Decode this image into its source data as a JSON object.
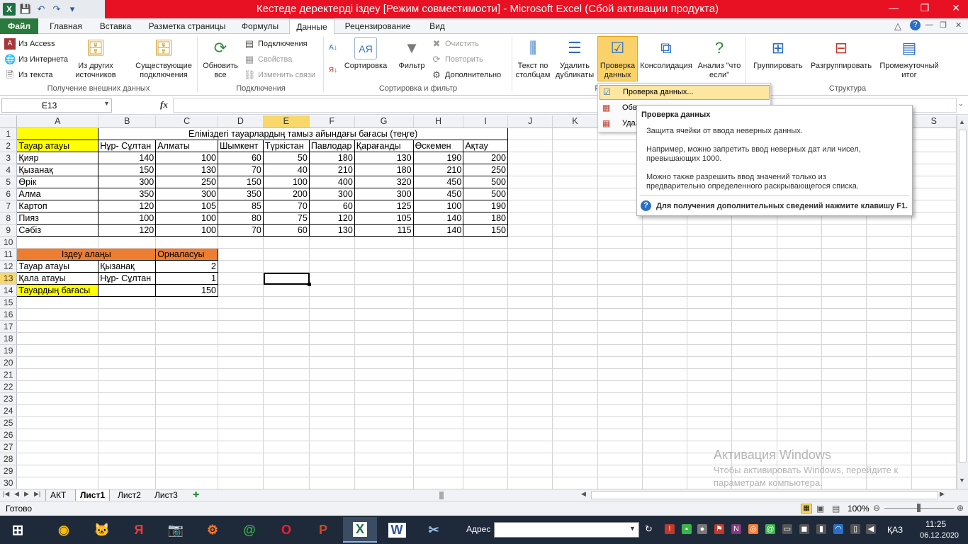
{
  "window": {
    "title": "Кестеде деректерді іздеу  [Режим совместимости]  -  Microsoft Excel (Сбой активации продукта)",
    "app_icon": "X"
  },
  "tabs": [
    "Файл",
    "Главная",
    "Вставка",
    "Разметка страницы",
    "Формулы",
    "Данные",
    "Рецензирование",
    "Вид"
  ],
  "active_tab": "Данные",
  "ribbon": {
    "get_external": {
      "access": "Из Access",
      "web": "Из Интернета",
      "text": "Из текста",
      "other": "Из других источников",
      "existing": "Существующие подключения",
      "label": "Получение внешних данных"
    },
    "connections": {
      "refresh": "Обновить все",
      "connections": "Подключения",
      "properties": "Свойства",
      "edit_links": "Изменить связи",
      "label": "Подключения"
    },
    "sort_filter": {
      "az": "А↓",
      "sort": "Сортировка",
      "filter": "Фильтр",
      "clear": "Очистить",
      "reapply": "Повторить",
      "advanced": "Дополнительно",
      "label": "Сортировка и фильтр"
    },
    "data_tools": {
      "text_to_columns": "Текст по столбцам",
      "remove_dup": "Удалить дубликаты",
      "validation": "Проверка данных",
      "consolidation": "Консолидация",
      "whatif": "Анализ \"что если\"",
      "label": "Р"
    },
    "outline": {
      "group": "Группировать",
      "ungroup": "Разгруппировать",
      "subtotal": "Промежуточный итог",
      "label": "Структура"
    }
  },
  "formula_bar": {
    "name_box": "E13",
    "fx": "fx",
    "value": ""
  },
  "columns": [
    "A",
    "B",
    "C",
    "D",
    "E",
    "F",
    "G",
    "H",
    "I",
    "J",
    "K",
    "L",
    "M",
    "N",
    "O",
    "P",
    "Q",
    "R",
    "S"
  ],
  "rows": [
    [
      "",
      "Еліміздегі тауарлардың тамыз айындағы бағасы (теңге)",
      "",
      "",
      "",
      "",
      "",
      "",
      ""
    ],
    [
      "Тауар атауы",
      "Нұр- Сұлтан",
      "Алматы",
      "Шымкент",
      "Түркістан",
      "Павлодар",
      "Қарағанды",
      "Өскемен",
      "Ақтау"
    ],
    [
      "Қияр",
      "140",
      "100",
      "60",
      "50",
      "180",
      "130",
      "190",
      "200"
    ],
    [
      "Қызанақ",
      "150",
      "130",
      "70",
      "40",
      "210",
      "180",
      "210",
      "250"
    ],
    [
      "Өрік",
      "300",
      "250",
      "150",
      "100",
      "400",
      "320",
      "450",
      "500"
    ],
    [
      "Алма",
      "350",
      "300",
      "350",
      "200",
      "300",
      "300",
      "450",
      "500"
    ],
    [
      "Картоп",
      "120",
      "105",
      "85",
      "70",
      "60",
      "125",
      "100",
      "190"
    ],
    [
      "Пияз",
      "100",
      "100",
      "80",
      "75",
      "120",
      "105",
      "140",
      "180"
    ],
    [
      "Сәбіз",
      "120",
      "100",
      "70",
      "60",
      "130",
      "115",
      "140",
      "150"
    ],
    [
      "",
      "",
      "",
      "",
      "",
      "",
      "",
      "",
      ""
    ],
    [
      "Іздеу алаңы",
      "",
      "Орналасуы",
      "",
      "",
      "",
      "",
      "",
      ""
    ],
    [
      "Тауар атауы",
      "Қызанақ",
      "2",
      "",
      "",
      "",
      "",
      "",
      ""
    ],
    [
      "Қала атауы",
      "Нұр- Сұлтан",
      "1",
      "",
      "",
      "",
      "",
      "",
      ""
    ],
    [
      "Тауардың бағасы",
      "",
      "150",
      "",
      "",
      "",
      "",
      "",
      ""
    ]
  ],
  "row_numbers": [
    "1",
    "2",
    "3",
    "4",
    "5",
    "6",
    "7",
    "8",
    "9",
    "10",
    "11",
    "12",
    "13",
    "14",
    "15",
    "16",
    "17",
    "18",
    "19",
    "20",
    "21",
    "22",
    "23",
    "24",
    "25",
    "26",
    "27",
    "28",
    "29",
    "30"
  ],
  "dropdown": {
    "items": [
      "Проверка данных...",
      "Обведение неверных данных",
      "Удалить обводку неверных данных"
    ]
  },
  "tooltip": {
    "title": "Проверка данных",
    "line1": "Защита ячейки от ввода неверных данных.",
    "line2": "Например, можно запретить ввод неверных дат или чисел, превышающих 1000.",
    "line3": "Можно также разрешить ввод значений только из предварительно определенного раскрывающегося списка.",
    "help": "Для получения дополнительных сведений нажмите клавишу F1."
  },
  "sheets": [
    "АКТ",
    "Лист1",
    "Лист2",
    "Лист3"
  ],
  "active_sheet": "Лист1",
  "status": {
    "ready": "Готово",
    "zoom": "100%"
  },
  "watermark": {
    "line1": "Активация Windows",
    "line2": "Чтобы активировать Windows, перейдите к",
    "line3": "параметрам компьютера."
  },
  "taskbar": {
    "address_label": "Адрес",
    "lang": "ҚАЗ",
    "time": "11:25",
    "date": "06.12.2020"
  }
}
